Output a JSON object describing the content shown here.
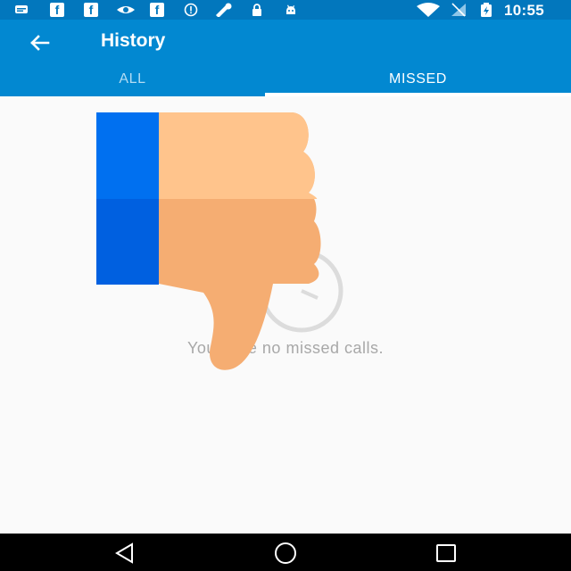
{
  "status_bar": {
    "time": "10:55",
    "icons": [
      "message-icon",
      "facebook-icon",
      "facebook-icon",
      "eye-icon",
      "facebook-icon",
      "info-icon",
      "tool-icon",
      "lock-icon",
      "android-icon",
      "wifi-icon",
      "no-signal-icon",
      "battery-charging-icon"
    ],
    "fb_glyph": "f"
  },
  "app_bar": {
    "title": "History",
    "back_icon": "arrow-left-icon"
  },
  "tabs": [
    {
      "label": "ALL",
      "selected": false
    },
    {
      "label": "MISSED",
      "selected": true
    }
  ],
  "empty_state": {
    "icon": "clock-icon",
    "message": "You have no missed calls."
  },
  "overlay": {
    "icon": "thumbs-down-icon"
  },
  "nav_bar": {
    "buttons": [
      "back-triangle-icon",
      "home-circle-icon",
      "recents-square-icon"
    ]
  },
  "colors": {
    "status_bar": "#0277bd",
    "app_bar": "#0288d1",
    "tab_inactive": "#b3dcf3",
    "empty_text": "#a8a8a8",
    "thumb_cuff_light": "#0070f0",
    "thumb_cuff_dark": "#0060e0",
    "thumb_skin_light": "#ffc48c",
    "thumb_skin_dark": "#f5ad72"
  }
}
